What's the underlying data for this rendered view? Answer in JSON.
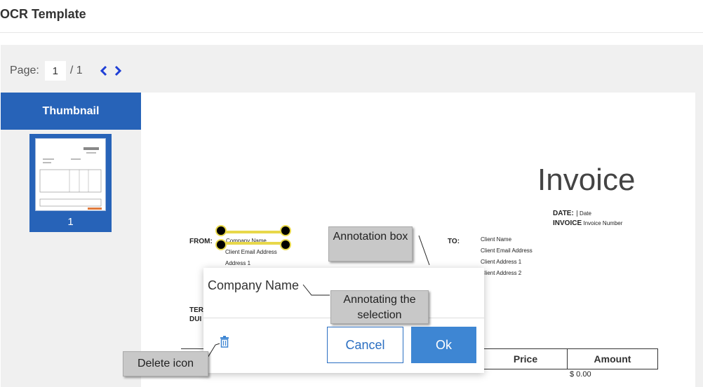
{
  "app": {
    "title": "OCR Template"
  },
  "pagebar": {
    "label": "Page:",
    "current": "1",
    "total": "/ 1"
  },
  "thumbnail": {
    "header": "Thumbnail",
    "page_number": "1"
  },
  "document": {
    "title": "Invoice",
    "date_label": "DATE:",
    "date_value": "Date",
    "invoice_label": "INVOICE",
    "invoice_value": "Invoice Number",
    "from_label": "FROM:",
    "from_lines": [
      "Company Name",
      "Client Email Address",
      "Address 1"
    ],
    "to_label": "TO:",
    "to_lines": [
      "Client Name",
      "Client Email Address",
      "Client Address 1",
      "Client Address 2"
    ],
    "terms_partial": [
      "TER",
      "DUI"
    ],
    "table_headers": [
      "Price",
      "Amount"
    ],
    "amount_partial": "$ 0.00"
  },
  "popup": {
    "selection_text": "Company Name",
    "cancel_label": "Cancel",
    "ok_label": "Ok"
  },
  "callouts": {
    "annotation_box": "Annotation box",
    "annotating": "Annotating the selection",
    "delete_icon": "Delete icon"
  },
  "colors": {
    "accent_blue": "#2763b8",
    "button_blue": "#3e86d3",
    "highlight_yellow": "#e8d84a"
  },
  "icons": {
    "prev": "chevron-left-icon",
    "next": "chevron-right-icon",
    "delete": "trash-icon"
  }
}
